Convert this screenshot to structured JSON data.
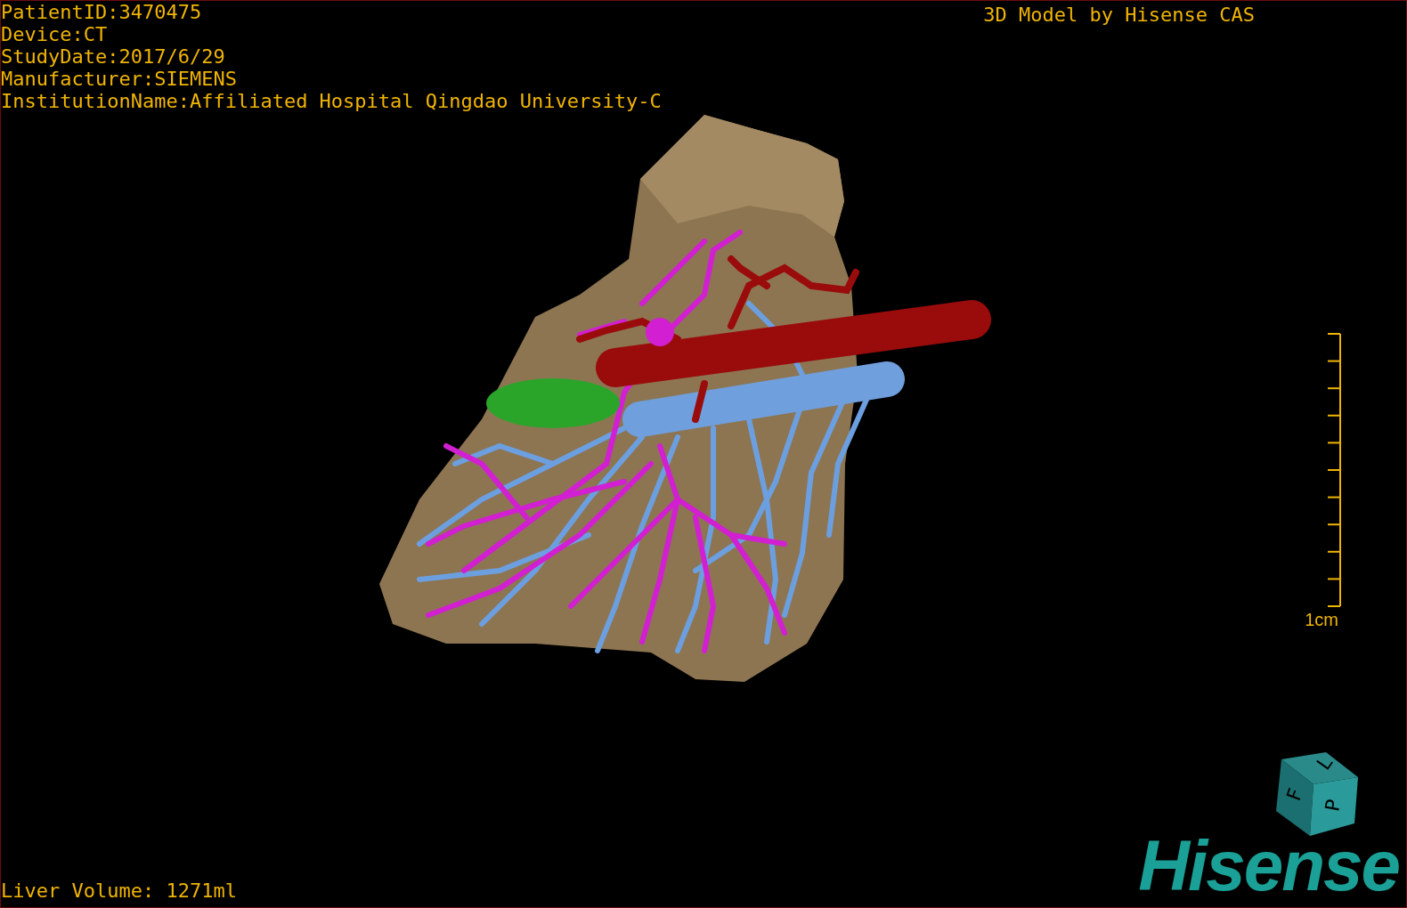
{
  "viewer": {
    "patient_info": [
      "PatientID:3470475",
      "Device:CT",
      "StudyDate:2017/6/29",
      "Manufacturer:SIEMENS",
      "InstitutionName:Affiliated Hospital Qingdao University-C"
    ],
    "title": "3D Model by Hisense CAS",
    "scale_bar": {
      "label": "1cm"
    },
    "orientation_cube": {
      "faces": [
        "F",
        "L",
        "P"
      ]
    },
    "footer": "Liver Volume: 1271ml",
    "logo": "Hisense"
  }
}
